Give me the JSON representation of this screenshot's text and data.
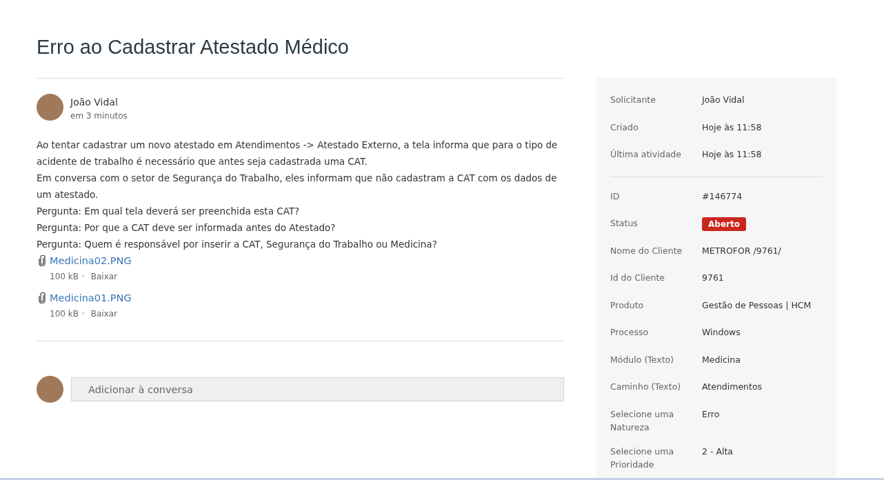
{
  "title": "Erro ao Cadastrar Atestado Médico",
  "post": {
    "author": "João Vidal",
    "time": "em 3 minutos",
    "lines": [
      "Ao tentar cadastrar um novo atestado em Atendimentos -> Atestado Externo, a tela informa que para o tipo de acidente de trabalho é necessário que antes seja cadastrada uma CAT.",
      "Em conversa com o setor de Segurança do Trabalho, eles informam que não cadastram a CAT com os dados de um atestado.",
      "Pergunta: Em qual tela deverá ser preenchida esta CAT?",
      "Pergunta: Por que a CAT deve ser informada antes do Atestado?",
      "Pergunta: Quem é responsável por inserir a CAT, Segurança do Trabalho ou Medicina?"
    ],
    "attachments": [
      {
        "name": "Medicina02.PNG",
        "size": "100 kB",
        "separator": "·",
        "action": "Baixar"
      },
      {
        "name": "Medicina01.PNG",
        "size": "100 kB",
        "separator": "·",
        "action": "Baixar"
      }
    ]
  },
  "reply": {
    "placeholder": "Adicionar à conversa"
  },
  "details": [
    [
      {
        "label": "Solicitante",
        "value": "João Vidal",
        "kind": "text"
      },
      {
        "label": "Criado",
        "value": "Hoje às 11:58",
        "kind": "text"
      },
      {
        "label": "Última atividade",
        "value": "Hoje às 11:58",
        "kind": "text"
      }
    ],
    [
      {
        "label": "ID",
        "value": "#146774",
        "kind": "text"
      },
      {
        "label": "Status",
        "value": "Aberto",
        "kind": "badge"
      },
      {
        "label": "Nome do Cliente",
        "value": "METROFOR /9761/",
        "kind": "text"
      },
      {
        "label": "Id do Cliente",
        "value": "9761",
        "kind": "text"
      },
      {
        "label": "Produto",
        "value": "Gestão de Pessoas | HCM",
        "kind": "text"
      },
      {
        "label": "Processo",
        "value": "Windows",
        "kind": "text"
      },
      {
        "label": "Módulo (Texto)",
        "value": "Medicina",
        "kind": "text"
      },
      {
        "label": "Caminho (Texto)",
        "value": "Atendimentos",
        "kind": "text"
      },
      {
        "label": "Selecione uma Natureza",
        "value": "Erro",
        "kind": "text"
      },
      {
        "label": "Selecione uma Prioridade",
        "value": "2 - Alta",
        "kind": "text"
      }
    ]
  ]
}
